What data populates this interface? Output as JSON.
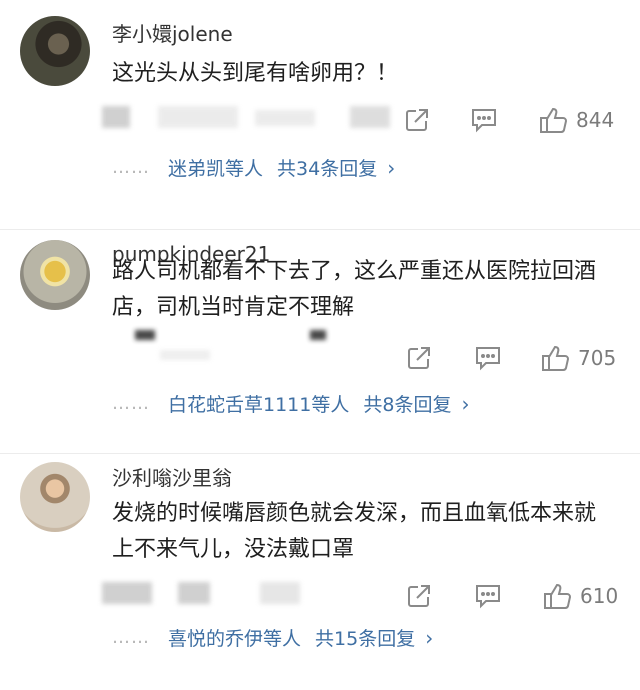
{
  "comments": [
    {
      "username": "李小嬛jolene",
      "text": "这光头从头到尾有啥卵用？！",
      "likes": "844",
      "reply_names": "迷弟凯等人",
      "reply_count": "共34条回复"
    },
    {
      "username": "pumpkindeer21",
      "text": "路人司机都看不下去了，这么严重还从医院拉回酒店，司机当时肯定不理解",
      "likes": "705",
      "reply_names": "白花蛇舌草1111等人",
      "reply_count": "共8条回复"
    },
    {
      "username": "沙利嗡沙里翁",
      "text": "发烧的时候嘴唇颜色就会发深，而且血氧低本来就上不来气儿，没法戴口罩",
      "likes": "610",
      "reply_names": "喜悦的乔伊等人",
      "reply_count": "共15条回复"
    }
  ],
  "dots": "……",
  "icons": [
    "share-icon",
    "comment-icon",
    "like-icon",
    "chevron-right-icon"
  ]
}
